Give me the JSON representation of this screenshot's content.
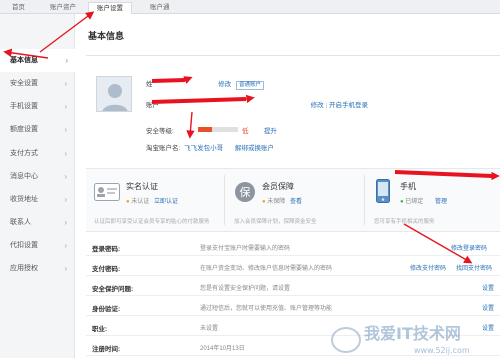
{
  "top_nav": {
    "tabs": [
      {
        "label": "首页"
      },
      {
        "label": "账户资产"
      },
      {
        "label": "账户设置"
      },
      {
        "label": "账户通"
      }
    ]
  },
  "sidebar": {
    "items": [
      {
        "label": "基本信息"
      },
      {
        "label": "安全设置"
      },
      {
        "label": "手机设置"
      },
      {
        "label": "额度设置"
      },
      {
        "label": "支付方式"
      },
      {
        "label": "消息中心"
      },
      {
        "label": "收货地址"
      },
      {
        "label": "联系人"
      },
      {
        "label": "代扣设置"
      },
      {
        "label": "应用授权"
      }
    ]
  },
  "main": {
    "title": "基本信息",
    "profile": {
      "name_label": "姓",
      "name_edit": "修改",
      "name_badge": "普通账户",
      "account_label": "账户",
      "account_edit": "修改",
      "account_phone_login": "开启手机登录",
      "security_label": "安全等级:",
      "security_level": "低",
      "security_fill": 0.35,
      "security_upgrade": "提升",
      "taobao_label": "淘宝账户名:",
      "taobao_value": "飞飞发包小哥",
      "taobao_unbind": "解绑或换账户"
    },
    "services": [
      {
        "title": "实名认证",
        "status": "未认证",
        "action": "立即认证",
        "desc": "认证后即可享受认证会员专享的贴心的付款服务"
      },
      {
        "title": "会员保障",
        "status": "未保障",
        "action": "查看",
        "desc": "加入会员保障计划，保障资金安全"
      },
      {
        "title": "手机",
        "status": "已绑定",
        "action": "管理",
        "desc": "您可享有手机相关的服务"
      }
    ],
    "rows": [
      {
        "label": "登录密码:",
        "desc": "登录支付宝账户时需要输入的密码",
        "actions": [
          "修改登录密码"
        ]
      },
      {
        "label": "支付密码:",
        "desc": "在账户资金变动、修改账户信息时需要输入的密码",
        "actions": [
          "修改支付密码",
          "找回支付密码"
        ]
      },
      {
        "label": "安全保护问题:",
        "desc": "您是有设置安全保护问题，请设置",
        "actions": [
          "设置"
        ]
      },
      {
        "label": "身份验证:",
        "desc": "通过短信后，您就可以使用充值、账户管理等功能",
        "actions": [
          "设置"
        ]
      },
      {
        "label": "职业:",
        "desc": "未设置",
        "actions": [
          "设置"
        ]
      },
      {
        "label": "注册时间:",
        "desc": "2014年10月13日",
        "actions": []
      }
    ]
  },
  "colors": {
    "link": "#2a6fb8",
    "arrow": "#e8131f",
    "danger": "#e94f2a",
    "sidebar_bg": "#f4f5f7"
  },
  "watermark": {
    "title": "我爱IT技术网",
    "url": "www.52ij.com"
  }
}
